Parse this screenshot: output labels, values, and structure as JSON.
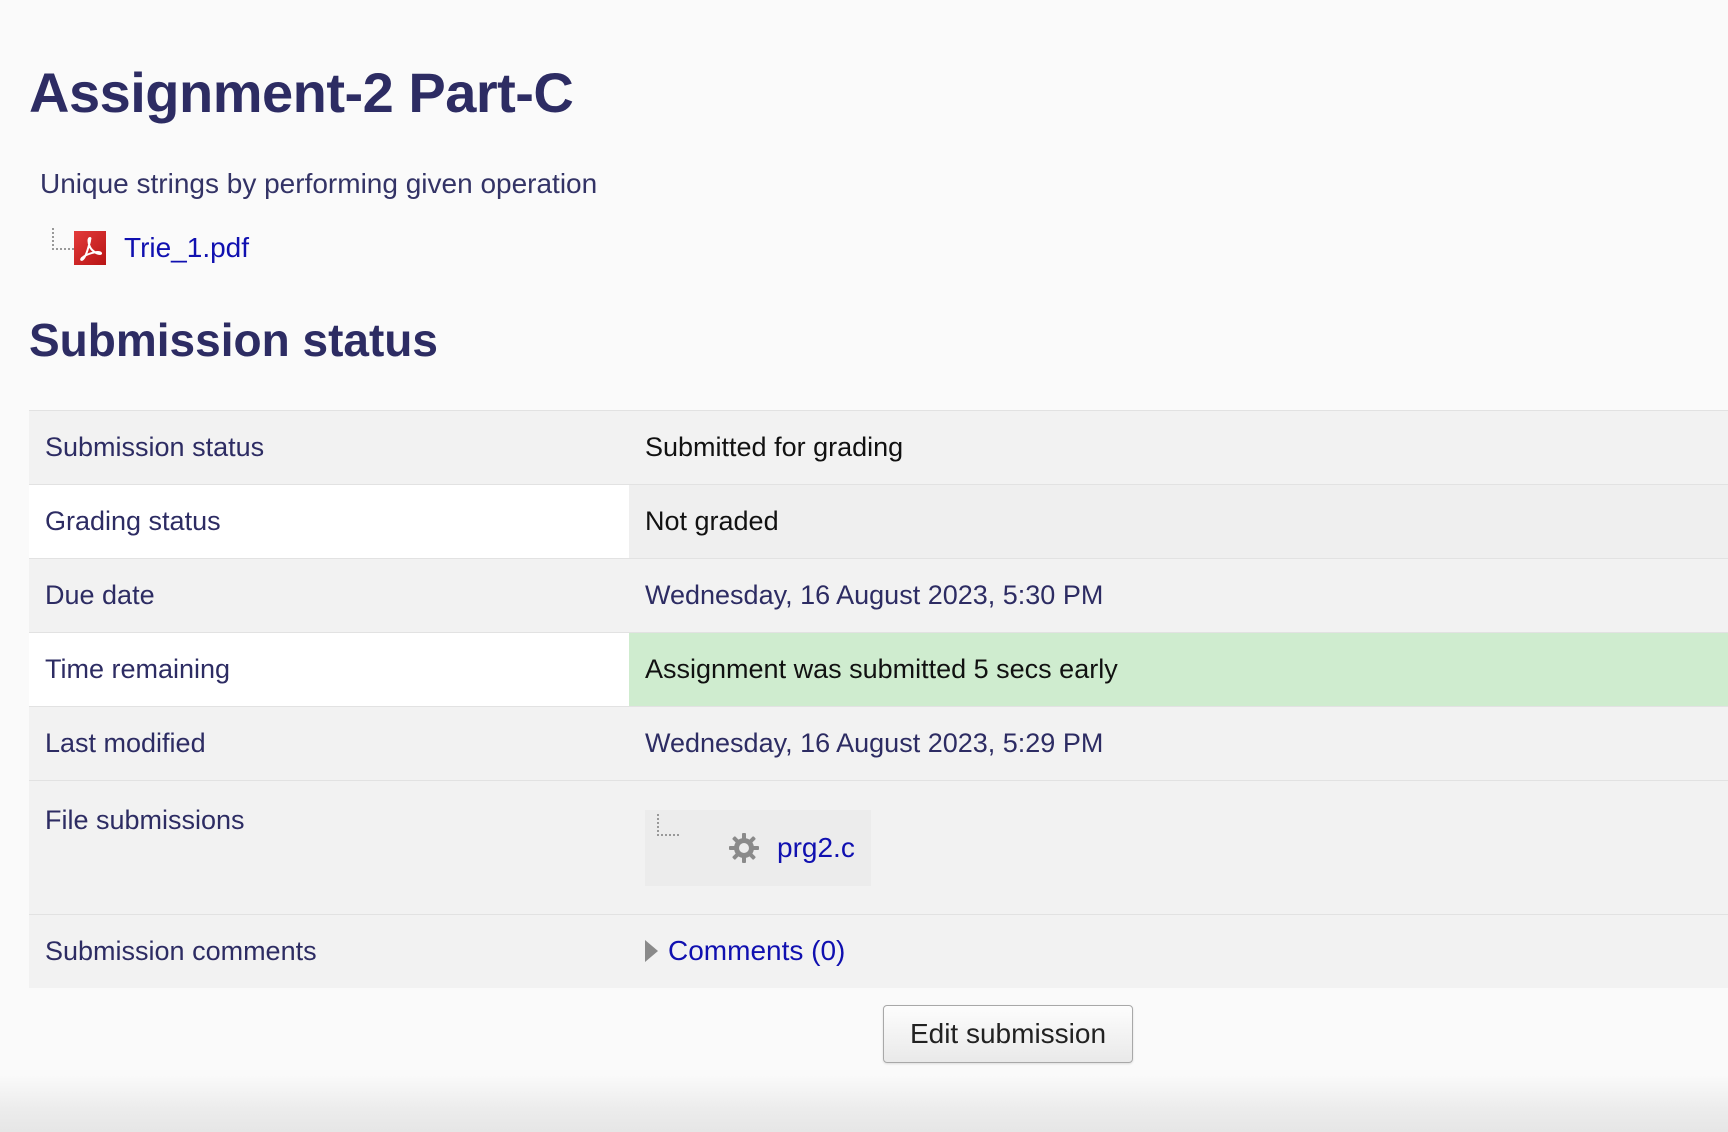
{
  "page": {
    "title": "Assignment-2 Part-C",
    "intro": "Unique strings by performing given operation",
    "attachment": {
      "name": "Trie_1.pdf",
      "icon": "pdf-icon"
    }
  },
  "submission": {
    "heading": "Submission status",
    "rows": [
      {
        "label": "Submission status",
        "value": "Submitted for grading"
      },
      {
        "label": "Grading status",
        "value": "Not graded"
      },
      {
        "label": "Due date",
        "value": "Wednesday, 16 August 2023, 5:30 PM"
      },
      {
        "label": "Time remaining",
        "value": "Assignment was submitted 5 secs early"
      },
      {
        "label": "Last modified",
        "value": "Wednesday, 16 August 2023, 5:29 PM"
      },
      {
        "label": "File submissions",
        "file": {
          "name": "prg2.c",
          "icon": "gear-icon"
        }
      },
      {
        "label": "Submission comments",
        "comments": "Comments (0)"
      }
    ],
    "edit_button": "Edit submission"
  },
  "colors": {
    "heading": "#2d2c63",
    "link": "#1010b0",
    "success_bg": "#cfeccf"
  }
}
